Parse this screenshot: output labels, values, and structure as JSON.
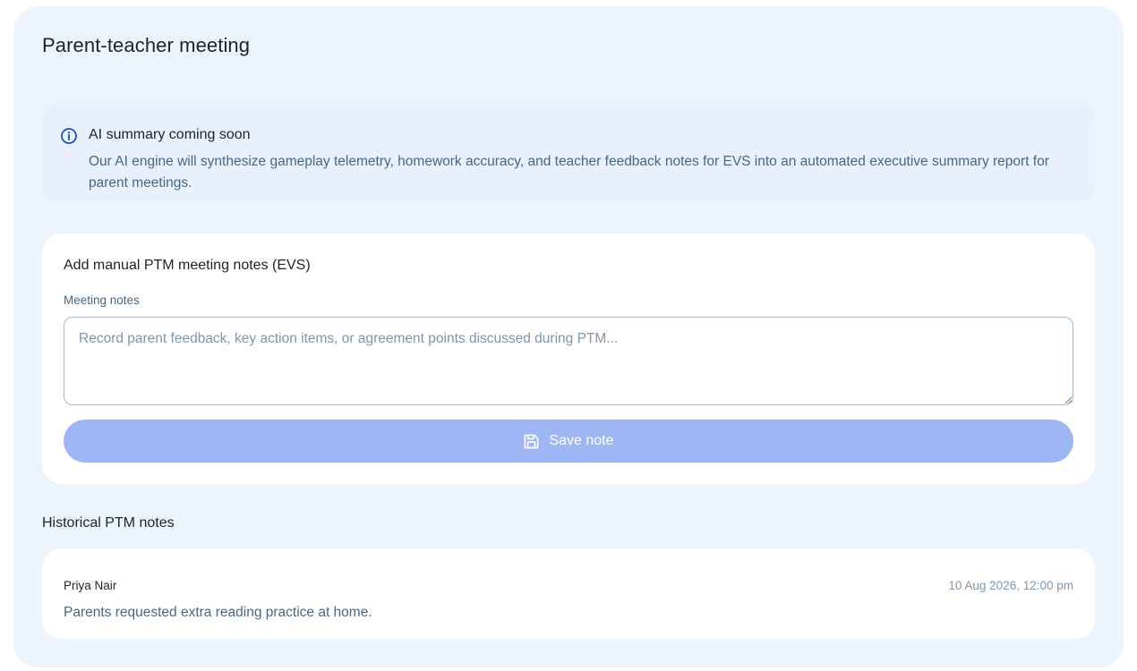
{
  "header": {
    "title": "Parent-teacher meeting"
  },
  "info_banner": {
    "title": "AI summary coming soon",
    "body": "Our AI engine will synthesize gameplay telemetry, homework accuracy, and teacher feedback notes for EVS into an automated executive summary report for parent meetings.",
    "icon": "info-icon",
    "accent_color": "#1f4fb8"
  },
  "notes_form": {
    "title": "Add manual PTM meeting notes (EVS)",
    "field_label": "Meeting notes",
    "value": "",
    "placeholder": "Record parent feedback, key action items, or agreement points discussed during PTM...",
    "save_label": "Save note",
    "save_icon": "floppy-disk-icon",
    "save_button_color": "#9fb6f5"
  },
  "history": {
    "title": "Historical PTM notes",
    "items": [
      {
        "author": "Priya Nair",
        "timestamp": "10 Aug 2026, 12:00 pm",
        "text": "Parents requested extra reading practice at home."
      }
    ]
  }
}
